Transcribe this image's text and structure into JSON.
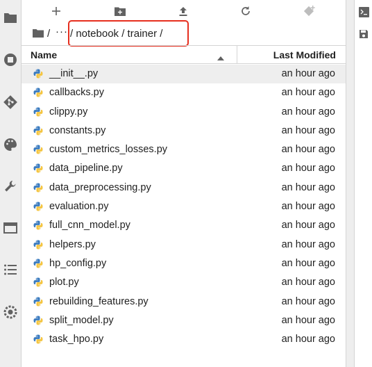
{
  "breadcrumbs": {
    "separator": "/",
    "ellipsis": "···",
    "path": "/ notebook / trainer /"
  },
  "columns": {
    "name": "Name",
    "last_modified": "Last Modified"
  },
  "files": [
    {
      "name": "__init__.py",
      "modified": "an hour ago"
    },
    {
      "name": "callbacks.py",
      "modified": "an hour ago"
    },
    {
      "name": "clippy.py",
      "modified": "an hour ago"
    },
    {
      "name": "constants.py",
      "modified": "an hour ago"
    },
    {
      "name": "custom_metrics_losses.py",
      "modified": "an hour ago"
    },
    {
      "name": "data_pipeline.py",
      "modified": "an hour ago"
    },
    {
      "name": "data_preprocessing.py",
      "modified": "an hour ago"
    },
    {
      "name": "evaluation.py",
      "modified": "an hour ago"
    },
    {
      "name": "full_cnn_model.py",
      "modified": "an hour ago"
    },
    {
      "name": "helpers.py",
      "modified": "an hour ago"
    },
    {
      "name": "hp_config.py",
      "modified": "an hour ago"
    },
    {
      "name": "plot.py",
      "modified": "an hour ago"
    },
    {
      "name": "rebuilding_features.py",
      "modified": "an hour ago"
    },
    {
      "name": "split_model.py",
      "modified": "an hour ago"
    },
    {
      "name": "task_hpo.py",
      "modified": "an hour ago"
    }
  ],
  "icons": {
    "toolbar": [
      "new-launcher-icon",
      "new-folder-icon",
      "upload-icon",
      "refresh-icon",
      "git-clone-icon"
    ],
    "activity_bar": [
      "folder-icon",
      "running-icon",
      "git-icon",
      "palette-icon",
      "wrench-icon",
      "tabs-icon",
      "toc-icon",
      "extension-icon"
    ],
    "right_bar": [
      "terminal-icon",
      "save-icon"
    ],
    "file": "python-file-icon"
  },
  "colors": {
    "highlight_box": "#e62e1e",
    "selected_row": "#eeeeee",
    "python_blue": "#3b7bbf",
    "python_yellow": "#f4c542"
  }
}
